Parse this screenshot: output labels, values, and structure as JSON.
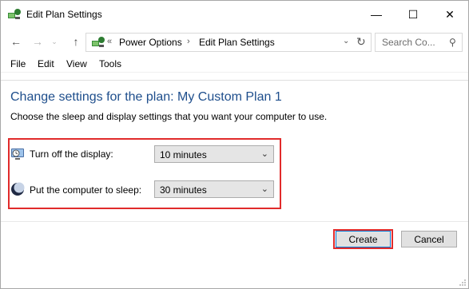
{
  "window": {
    "title": "Edit Plan Settings",
    "controls": {
      "minimize": "—",
      "maximize": "☐",
      "close": "✕"
    }
  },
  "nav": {
    "back_glyph": "←",
    "forward_glyph": "→",
    "dropdown_glyph": "⌄",
    "up_glyph": "↑",
    "address": {
      "prefix": "«",
      "crumbs": [
        "Power Options",
        "Edit Plan Settings"
      ],
      "separator": "›",
      "dropdown_glyph": "⌄",
      "refresh_glyph": "↻"
    },
    "search": {
      "placeholder": "Search Co...",
      "icon_glyph": "⚲"
    }
  },
  "menu": {
    "items": [
      "File",
      "Edit",
      "View",
      "Tools"
    ]
  },
  "content": {
    "heading": "Change settings for the plan: My Custom Plan 1",
    "description": "Choose the sleep and display settings that you want your computer to use.",
    "settings": [
      {
        "label": "Turn off the display:",
        "value": "10 minutes",
        "icon": "display-icon"
      },
      {
        "label": "Put the computer to sleep:",
        "value": "30 minutes",
        "icon": "sleep-moon-icon"
      }
    ],
    "select_arrow": "⌄"
  },
  "buttons": {
    "create": "Create",
    "cancel": "Cancel"
  },
  "colors": {
    "heading": "#1e4e8c",
    "highlight": "#e12b2b",
    "focus": "#0078d7"
  }
}
